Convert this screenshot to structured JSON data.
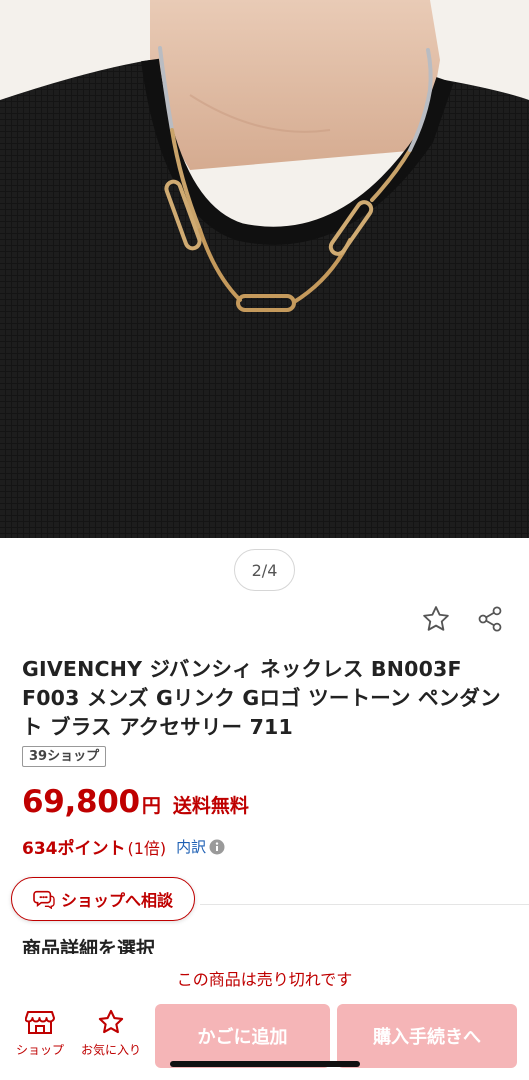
{
  "gallery": {
    "page_indicator": "2/4"
  },
  "product": {
    "title": "GIVENCHY ジバンシィ ネックレス BN003F F003 メンズ Gリンク Gロゴ ツートーン ペンダント ブラス アクセサリー 711",
    "shop_tag": "39ショップ",
    "price": "69,800",
    "currency_unit": "円",
    "shipping": "送料無料",
    "points": "634ポイント",
    "points_multiplier": "(1倍)",
    "points_breakdown": "内訳"
  },
  "actions": {
    "favorite_icon": "star-outline-icon",
    "share_icon": "share-icon",
    "consult_label": "ショップへ相談",
    "consult_icon": "chat-bubble-icon"
  },
  "section": {
    "heading": "商品詳細を選択"
  },
  "notice": {
    "sold_out": "この商品は売り切れです"
  },
  "bottom_bar": {
    "shop_label": "ショップ",
    "shop_icon": "store-icon",
    "favorite_label": "お気に入り",
    "favorite_icon": "star-outline-icon",
    "cart_label": "かごに追加",
    "checkout_label": "購入手続きへ"
  },
  "colors": {
    "accent": "#bf0000",
    "disabled_button": "#f5b5b7",
    "link": "#1d5fb4"
  }
}
